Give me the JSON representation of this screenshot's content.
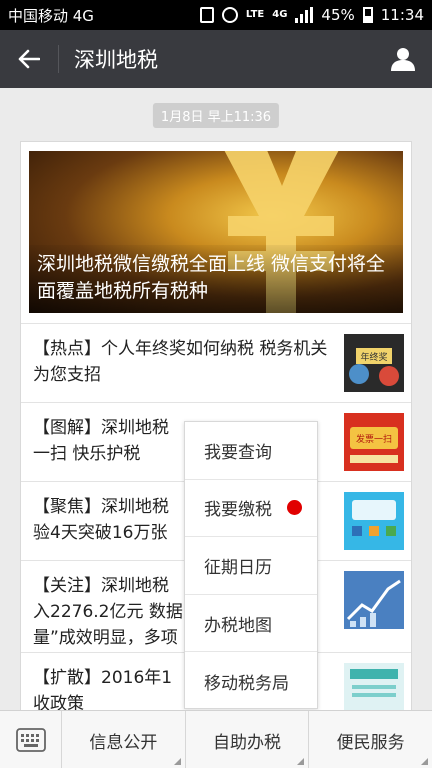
{
  "status_bar": {
    "carrier": "中国移动 4G",
    "net_small": "LTE",
    "net": "4G",
    "battery": "45%",
    "time": "11:34"
  },
  "header": {
    "title": "深圳地税"
  },
  "timestamp": "1月8日 早上11:36",
  "article": {
    "hero_caption": "深圳地税微信缴税全面上线 微信支付将全面覆盖地税所有税种",
    "items": [
      {
        "text": "【热点】个人年终奖如何纳税 税务机关为您支招",
        "thumb_text": "年终奖"
      },
      {
        "text": "【图解】深圳地税\n一扫 快乐护税",
        "thumb_text": "发票一扫"
      },
      {
        "text": "【聚焦】深圳地税\n验4天突破16万张"
      },
      {
        "text": "【关注】深圳地税\n入2276.2亿元 数据\n量”成效明显，多项"
      },
      {
        "text": "【扩散】2016年1\n收政策"
      }
    ]
  },
  "popup_menu": {
    "items": [
      "我要查询",
      "我要缴税",
      "征期日历",
      "办税地图",
      "移动税务局"
    ],
    "badge_color": "#e10000"
  },
  "bottom_menu": {
    "tabs": [
      "信息公开",
      "自助办税",
      "便民服务"
    ]
  },
  "colors": {
    "titlebar": "#393a3f",
    "statusbar": "#000000",
    "background": "#ebebeb"
  }
}
